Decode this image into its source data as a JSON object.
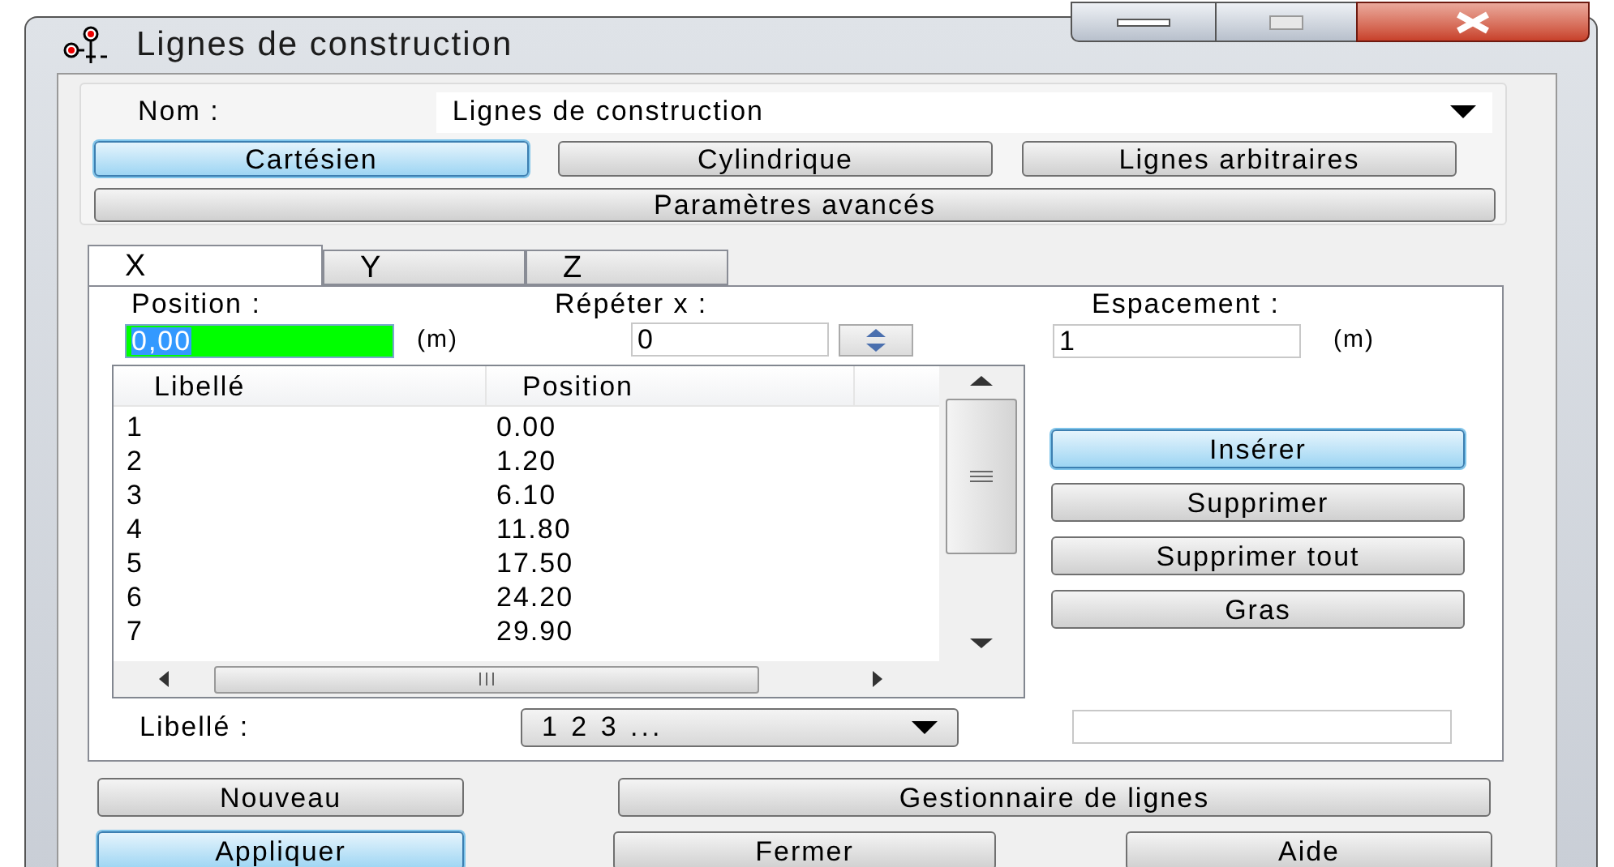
{
  "window": {
    "title": "Lignes de construction"
  },
  "name_field": {
    "label": "Nom :",
    "value": "Lignes de construction"
  },
  "mode_buttons": [
    {
      "label": "Cartésien",
      "selected": true
    },
    {
      "label": "Cylindrique",
      "selected": false
    },
    {
      "label": "Lignes arbitraires",
      "selected": false
    }
  ],
  "advanced_button": "Paramètres avancés",
  "tabs": [
    {
      "label": "X",
      "selected": true
    },
    {
      "label": "Y",
      "selected": false
    },
    {
      "label": "Z",
      "selected": false
    }
  ],
  "position": {
    "label": "Position :",
    "value": "0,00",
    "unit": "(m)"
  },
  "repeat": {
    "label": "Répéter x :",
    "value": "0"
  },
  "spacing": {
    "label": "Espacement :",
    "value": "1",
    "unit": "(m)"
  },
  "table": {
    "columns": [
      "Libellé",
      "Position"
    ],
    "rows": [
      [
        "1",
        "0.00"
      ],
      [
        "2",
        "1.20"
      ],
      [
        "3",
        "6.10"
      ],
      [
        "4",
        "11.80"
      ],
      [
        "5",
        "17.50"
      ],
      [
        "6",
        "24.20"
      ],
      [
        "7",
        "29.90"
      ]
    ]
  },
  "side_buttons": [
    {
      "label": "Insérer",
      "focused": true
    },
    {
      "label": "Supprimer",
      "focused": false
    },
    {
      "label": "Supprimer tout",
      "focused": false
    },
    {
      "label": "Gras",
      "focused": false
    }
  ],
  "label_field": {
    "label": "Libellé :",
    "value": "1 2 3 ..."
  },
  "bottom_buttons": [
    {
      "label": "Nouveau",
      "focused": false
    },
    {
      "label": "Gestionnaire de lignes",
      "focused": false
    },
    {
      "label": "Appliquer",
      "focused": true
    },
    {
      "label": "Fermer",
      "focused": false
    },
    {
      "label": "Aide",
      "focused": false
    }
  ]
}
